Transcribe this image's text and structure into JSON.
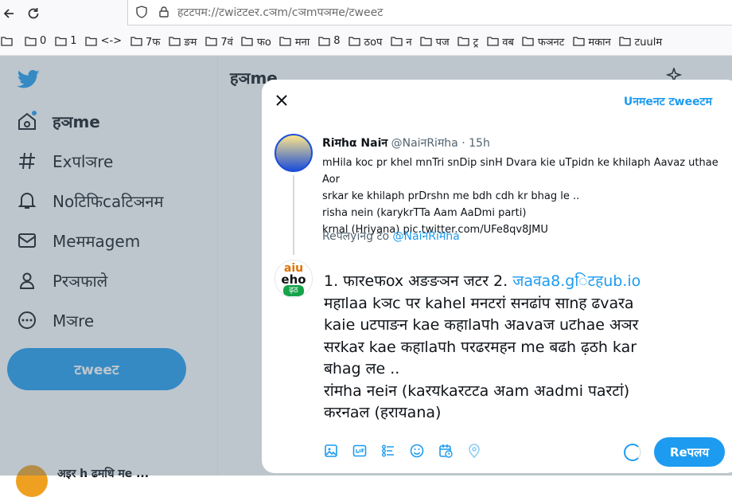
{
  "browser": {
    "url": "हटटपम://टwiटटeर.cञm/cञmपञमe/टweeट",
    "bookmarks": [
      {
        "label": ""
      },
      {
        "label": "0"
      },
      {
        "label": "1"
      },
      {
        "label": "<->"
      },
      {
        "label": "7फ"
      },
      {
        "label": "ङम"
      },
      {
        "label": "7वं"
      },
      {
        "label": "फo"
      },
      {
        "label": "मना"
      },
      {
        "label": "8"
      },
      {
        "label": "ठoप"
      },
      {
        "label": "न"
      },
      {
        "label": "पज"
      },
      {
        "label": "ट्र"
      },
      {
        "label": "वब"
      },
      {
        "label": "फञनट"
      },
      {
        "label": "मकान"
      },
      {
        "label": "टuulम"
      }
    ]
  },
  "sidebar": {
    "items": [
      {
        "label": "हञme",
        "icon": "home-icon"
      },
      {
        "label": "Exपlञre",
        "icon": "hash-icon"
      },
      {
        "label": "Noटिफिcaटिञनम",
        "icon": "bell-icon"
      },
      {
        "label": "Meममagem",
        "icon": "mail-icon"
      },
      {
        "label": "Pरञफाले",
        "icon": "user-icon"
      },
      {
        "label": "Mञre",
        "icon": "more-icon"
      }
    ],
    "tweet_button": "टweeट"
  },
  "main": {
    "title": "हञme",
    "bottom_account": "अइर h ढमधि मe ..."
  },
  "modal": {
    "unsent_label": "Uनमeनट टweeटम",
    "quoted": {
      "name": "Riमhα Naiन",
      "handle": "@NaiनRiमha",
      "time": "15h",
      "lines": [
        "mHila koc pr khel mnTri snDip sinH Dvara kie  uTpidn ke khilaph Aavaz uthae Aor",
        "srkar ke khilaph prDrshn me bdh cdh kr bhag le ..",
        "risha nein (karykrTTa Aam AaDmi parti)",
        "krnal (Hriyana) pic.twitter.com/UFe8qv8JMU"
      ]
    },
    "replying_prefix": "Reपलyiनg टo",
    "replying_handle": "@NaiनRiमha",
    "avatar_text": {
      "top": "aiu",
      "mid": "eho",
      "bottom": "ढ़ठ"
    },
    "compose": {
      "prefix": "1. फारeफox अङङञन जटर 2. ",
      "link": "जaवa8.gिटहub.io",
      "lines": [
        "महाlaa kञc पर kahel मनटरां सनढां​प साnह ढvaरa",
        "kaie  uटपाङन kae कहाlaपh अavaज uटhae अञर",
        "सरkaर kae कहाlaपh परढरमहन me बढh ढ़ठh kar",
        "बhag लe ..",
        "रांमha नeiन (kaरयkaरटटa अam अadmi पaरटां)",
        "करनaल (हरायana)"
      ]
    },
    "toolbar_icons": [
      "image-icon",
      "gif-icon",
      "poll-icon",
      "emoji-icon",
      "schedule-icon",
      "location-icon"
    ],
    "reply_button": "Reपलय"
  }
}
